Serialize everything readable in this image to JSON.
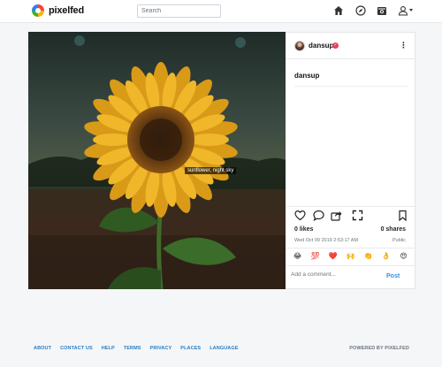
{
  "header": {
    "brand_name": "pixelfed",
    "search_placeholder": "Search",
    "icons": [
      "home-icon",
      "compass-icon",
      "camera-icon",
      "user-icon"
    ]
  },
  "post": {
    "image_alt_label": "sunflower, night sky",
    "author": "dansup",
    "verified_icon": "verified-badge-icon",
    "menu_icon": "more-options-icon",
    "caption_username": "dansup",
    "likes_text": "0 likes",
    "shares_text": "0 shares",
    "timestamp": "Wed Oct 09 2019 2:53:17 AM",
    "visibility": "Public",
    "actions": [
      "heart-icon",
      "comment-icon",
      "share-icon",
      "expand-icon",
      "bookmark-icon"
    ],
    "emojis": [
      "😂",
      "💯",
      "❤️",
      "🙌",
      "👏",
      "👌",
      "😍"
    ],
    "comment_placeholder": "Add a comment...",
    "post_button": "Post"
  },
  "footer": {
    "links": [
      "ABOUT",
      "CONTACT US",
      "HELP",
      "TERMS",
      "PRIVACY",
      "PLACES",
      "LANGUAGE"
    ],
    "powered_by": "POWERED BY PIXELFED"
  },
  "colors": {
    "accent": "#3b8fd9",
    "footer_link": "#2a7dc4",
    "background": "#f4f6f8",
    "verified": "#e4405f"
  }
}
